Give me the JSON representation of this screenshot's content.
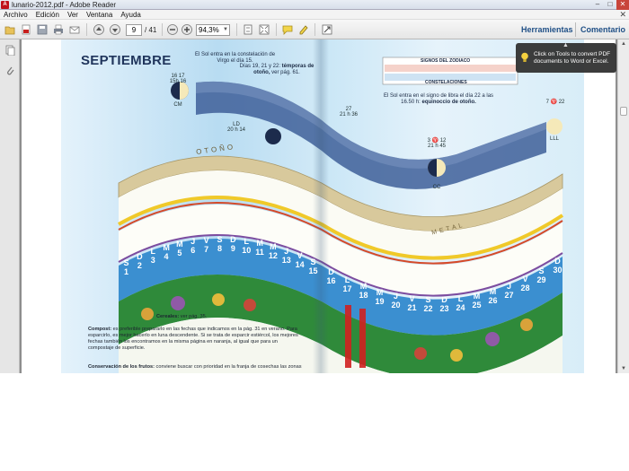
{
  "window": {
    "title": "lunario-2012.pdf - Adobe Reader",
    "app_icon": "adobe-reader-icon",
    "buttons": [
      "–",
      "□",
      "✕"
    ]
  },
  "menu": {
    "items": [
      "Archivo",
      "Edición",
      "Ver",
      "Ventana",
      "Ayuda"
    ],
    "close_glyph": "✕"
  },
  "toolbar": {
    "page_value": "9",
    "page_total": "/ 41",
    "zoom_value": "94,3%",
    "tools_label": "Herramientas",
    "comment_label": "Comentario"
  },
  "tooltip": {
    "text": "Click on Tools to convert PDF documents to Word or Excel."
  },
  "calendar": {
    "month": "SEPTIEMBRE",
    "note_virgo": "El Sol entra en la constelación de Virgo el día 15.",
    "note_temporas_1": "Días 19, 21 y 22:",
    "note_temporas_bold": "témporas",
    "note_temporas_2": "de otoño,",
    "note_temporas_3": "ver pág. 61.",
    "note_libra_1": "El Sol entra en el signo de libra el día",
    "note_libra_2": "22 a las 16.50 h:",
    "note_libra_bold": "equinoccio de otoño.",
    "season_label": "OTOÑO",
    "metal_label": "METAL",
    "signs_header": "SIGNOS DEL ZODIACO",
    "constellations_header": "CONSTELACIONES",
    "moon_labels": [
      {
        "top": "16  17",
        "bottom": "15h 16",
        "tag": "CM"
      },
      {
        "top": "LD",
        "bottom": "20 h 14",
        "tag": ""
      },
      {
        "top": "27",
        "bottom": "21 h 36",
        "tag": ""
      },
      {
        "top": "3 ♈ 12",
        "bottom": "21 h 45",
        "tag": "CC"
      },
      {
        "top": "7 ♈ 22",
        "bottom": "",
        "tag": "LLL"
      }
    ],
    "days_left": [
      {
        "letter": "S",
        "num": "1"
      },
      {
        "letter": "D",
        "num": "2"
      },
      {
        "letter": "L",
        "num": "3"
      },
      {
        "letter": "M",
        "num": "4"
      },
      {
        "letter": "M",
        "num": "5"
      },
      {
        "letter": "J",
        "num": "6"
      },
      {
        "letter": "V",
        "num": "7"
      },
      {
        "letter": "S",
        "num": "8"
      },
      {
        "letter": "D",
        "num": "9"
      },
      {
        "letter": "L",
        "num": "10"
      },
      {
        "letter": "M",
        "num": "11"
      },
      {
        "letter": "M",
        "num": "12"
      },
      {
        "letter": "J",
        "num": "13"
      },
      {
        "letter": "V",
        "num": "14"
      },
      {
        "letter": "S",
        "num": "15"
      }
    ],
    "days_right": [
      {
        "letter": "D",
        "num": "16"
      },
      {
        "letter": "L",
        "num": "17"
      },
      {
        "letter": "M",
        "num": "18"
      },
      {
        "letter": "M",
        "num": "19"
      },
      {
        "letter": "J",
        "num": "20"
      },
      {
        "letter": "V",
        "num": "21"
      },
      {
        "letter": "S",
        "num": "22"
      },
      {
        "letter": "D",
        "num": "23"
      },
      {
        "letter": "L",
        "num": "24"
      },
      {
        "letter": "M",
        "num": "25"
      },
      {
        "letter": "M",
        "num": "26"
      },
      {
        "letter": "J",
        "num": "27"
      },
      {
        "letter": "V",
        "num": "28"
      },
      {
        "letter": "S",
        "num": "29"
      },
      {
        "letter": "D",
        "num": "30"
      }
    ],
    "cereales_label": "Cereales:",
    "cereales_text": "ver pág. 35.",
    "compost_label": "Compost:",
    "compost_text": "es preferible prepararlo en las fechas que indicamos en la pág. 31 en verano. Para esparcirlo, es mejor hacerlo en luna descendente. Si se trata de esparcir estiércol, los mejores fechas también los encontramos en la misma página en naranja, al igual que para un compostaje de superficie.",
    "conservacion_label": "Conservación de los frutos:",
    "conservacion_text": "conviene buscar con prioridad en la franja de cosechas las zonas"
  },
  "colors": {
    "sky_band": "#3e5f99",
    "day_band": "#3b8fd0",
    "green_band": "#2f8a3a",
    "accent_red": "#d02020",
    "season_band": "#c9b98e"
  }
}
